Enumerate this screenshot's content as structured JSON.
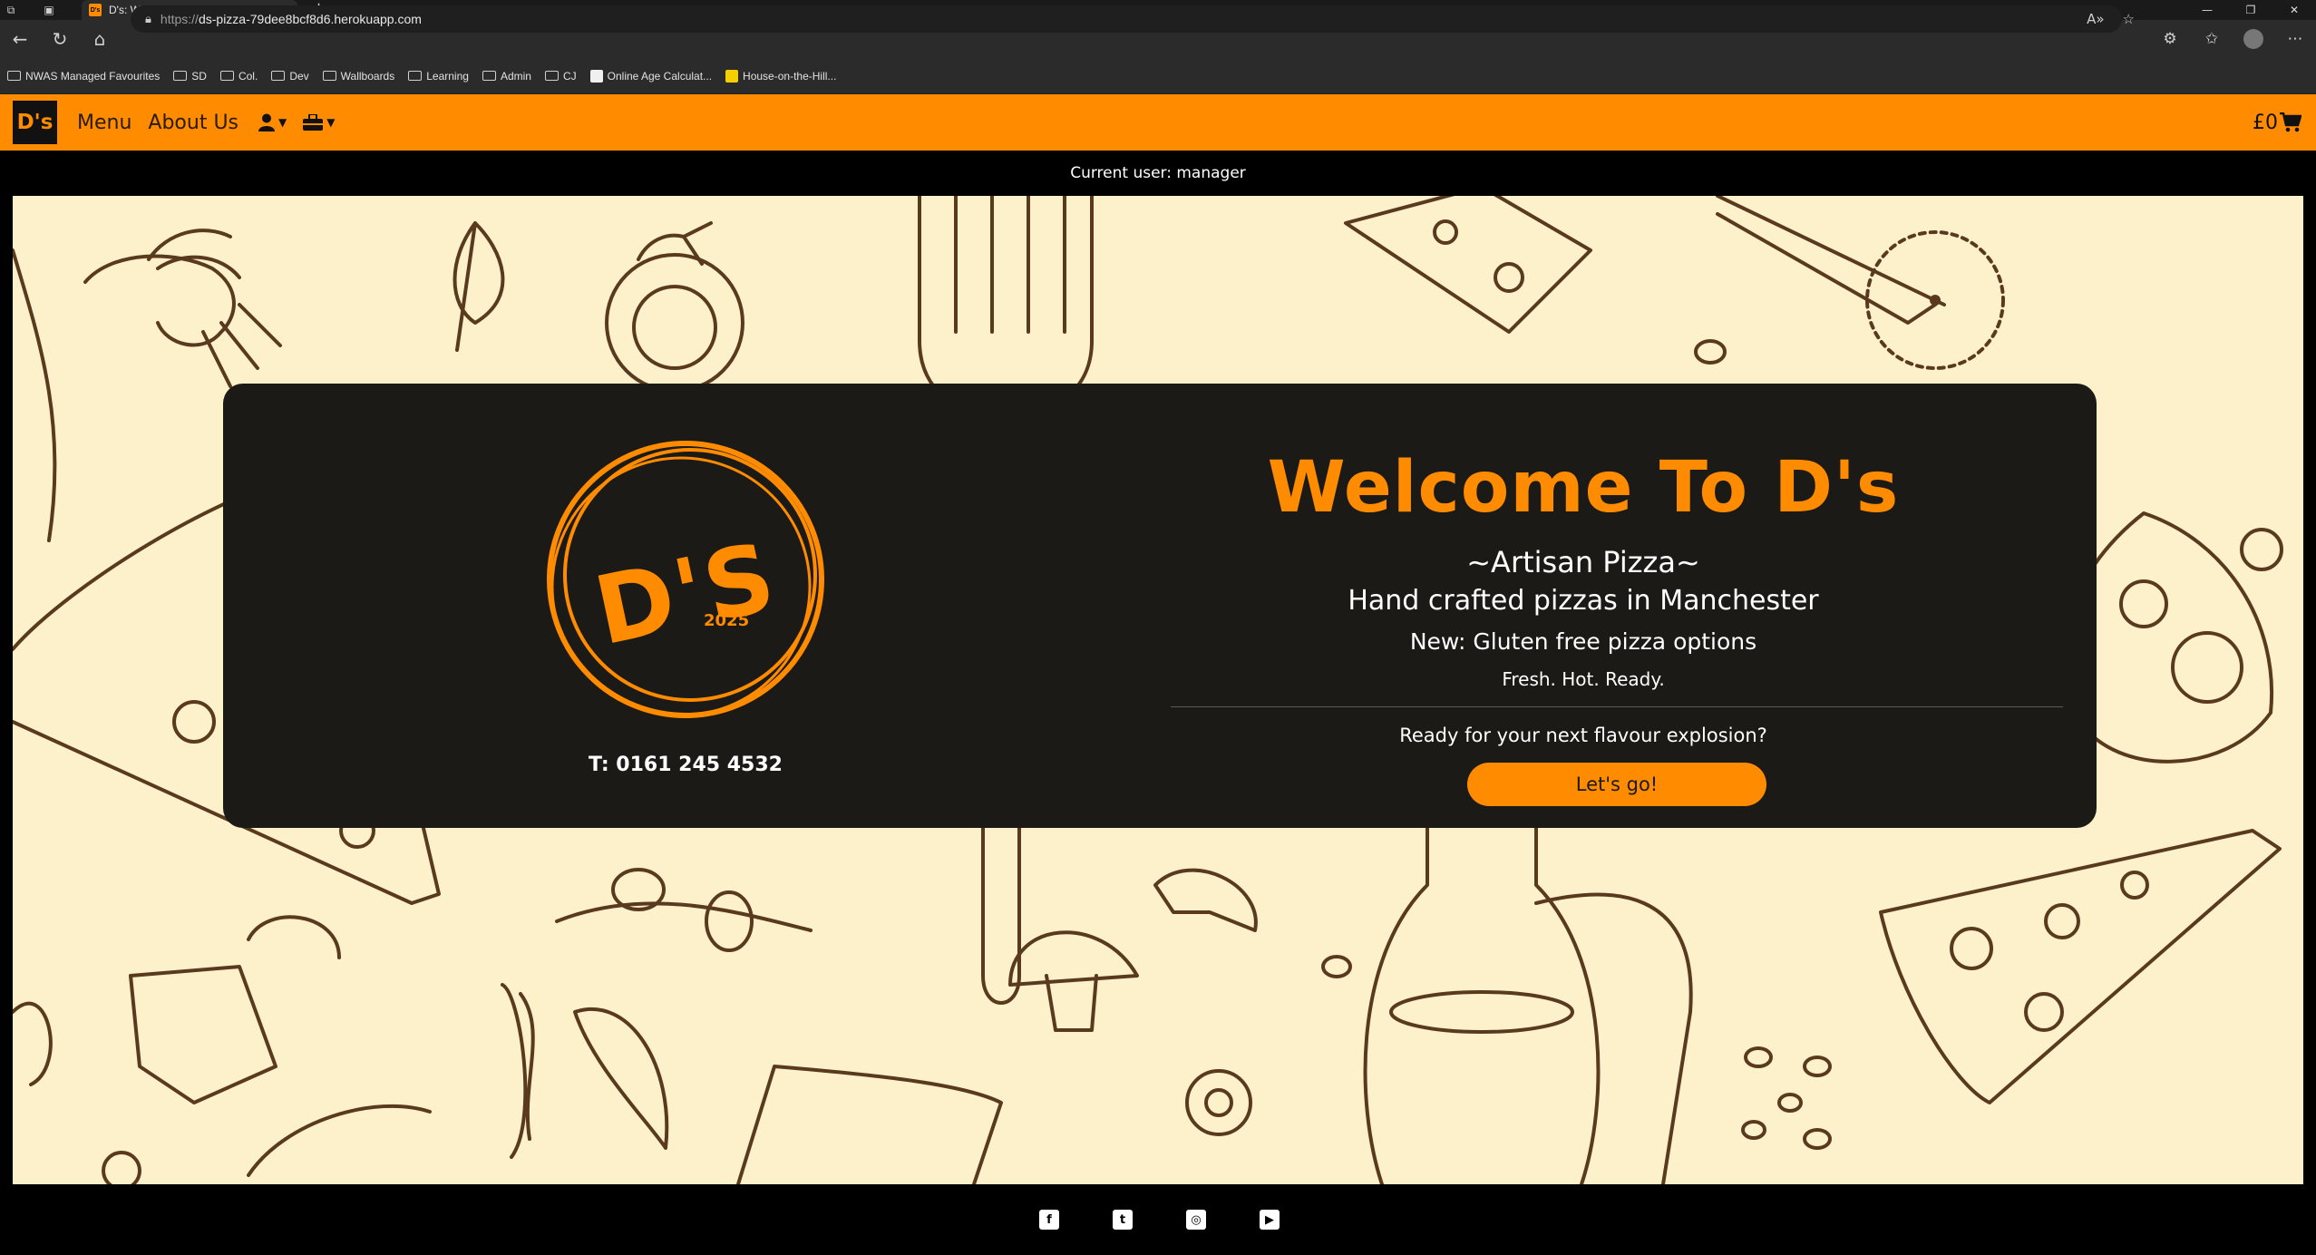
{
  "browser": {
    "tab_title": "D's: Welcome - Fresh Artisan Pizz",
    "tab_favicon_text": "D's",
    "url_protocol": "https://",
    "url_host": "ds-pizza-79dee8bcf8d6.herokuapp.com",
    "bookmarks": [
      {
        "label": "NWAS Managed Favourites",
        "type": "folder"
      },
      {
        "label": "SD",
        "type": "folder"
      },
      {
        "label": "Col.",
        "type": "folder"
      },
      {
        "label": "Dev",
        "type": "folder"
      },
      {
        "label": "Wallboards",
        "type": "folder"
      },
      {
        "label": "Learning",
        "type": "folder"
      },
      {
        "label": "Admin",
        "type": "folder"
      },
      {
        "label": "CJ",
        "type": "folder"
      },
      {
        "label": "Online Age Calculat...",
        "type": "link"
      },
      {
        "label": "House-on-the-Hill...",
        "type": "link"
      }
    ]
  },
  "nav": {
    "brand": "D's",
    "menu": "Menu",
    "about": "About Us",
    "account_icon": "user-icon",
    "admin_icon": "toolbox-icon",
    "bag_total": "£0",
    "bag_icon": "cart-icon"
  },
  "user_bar": "Current user: manager",
  "hero": {
    "logo_text": "D'S",
    "logo_year": "2025",
    "phone": "T: 0161 245 4532",
    "welcome": "Welcome To D's",
    "tagline": "~Artisan Pizza~",
    "subtitle": "Hand crafted pizzas in Manchester",
    "news": "New: Gluten free pizza options",
    "motto": "Fresh. Hot. Ready.",
    "prompt": "Ready for your next flavour explosion?",
    "cta": "Let's go!"
  },
  "footer": {
    "social": [
      "facebook-icon",
      "twitter-icon",
      "instagram-icon",
      "youtube-icon"
    ]
  },
  "colors": {
    "accent": "#ff8c00",
    "panel": "#1b1a17",
    "hero_bg": "#fdf1cc",
    "doodle": "#5a3a1e"
  }
}
